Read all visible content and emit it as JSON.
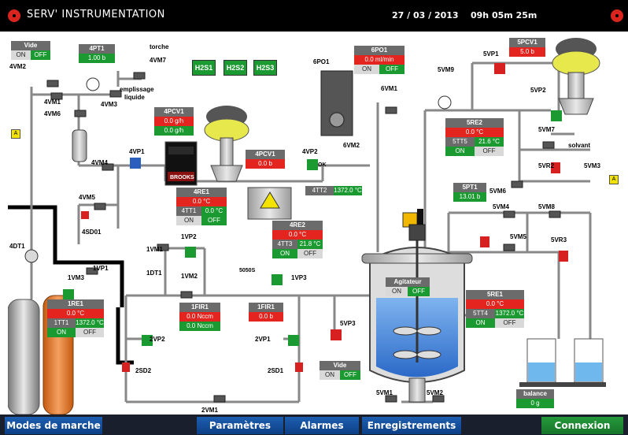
{
  "header": {
    "title": "SERV' INSTRUMENTATION",
    "date": "27 / 03 / 2013",
    "time": "09h 05m 25m"
  },
  "nav": {
    "modes": "Modes de marche",
    "params": "Paramètres",
    "alarms": "Alarmes",
    "records": "Enregistrements",
    "connect": "Connexion"
  },
  "labels": {
    "torche": "torche",
    "emplissage": "emplissage",
    "liquide": "liquide",
    "solvant": "solvant",
    "4vm2": "4VM2",
    "4vm7": "4VM7",
    "4vm1": "4VM1",
    "4vm3": "4VM3",
    "4vm6": "4VM6",
    "4vm4": "4VM4",
    "4vp1": "4VP1",
    "4vm5": "4VM5",
    "4sd01": "4SD01",
    "4dt1": "4DT1",
    "1vm3": "1VM3",
    "1vp1": "1VP1",
    "1dt1": "1DT1",
    "1vm2": "1VM2",
    "1vm1": "1VM1",
    "1vp2": "1VP2",
    "1vp3": "1VP3",
    "2vp2": "2VP2",
    "2sd2": "2SD2",
    "2vm1": "2VM1",
    "2vp1": "2VP1",
    "2sd1": "2SD1",
    "4vp2": "4VP2",
    "6po1": "6PO1",
    "6vm1": "6VM1",
    "6vm2": "6VM2",
    "5vp1": "5VP1",
    "5vm9": "5VM9",
    "5vp2": "5VP2",
    "5vm7": "5VM7",
    "5vr2": "5VR2",
    "5vm3": "5VM3",
    "5vm6": "5VM6",
    "5vm4": "5VM4",
    "5vm8": "5VM8",
    "5vm5": "5VM5",
    "5vr3": "5VR3",
    "5vp3": "5VP3",
    "5vm1": "5VM1",
    "5vm2": "5VM2",
    "h2s1": "H2S1",
    "h2s2": "H2S2",
    "h2s3": "H2S3",
    "a1": "A",
    "a2": "A",
    "brooks": "BROOKS",
    "ok": "OK",
    "sensor": "5050S"
  },
  "widgets": {
    "vide1": {
      "title": "Vide",
      "on": "ON",
      "off": "OFF"
    },
    "4pt1": {
      "title": "4PT1",
      "value": "1.00 b"
    },
    "4pcv1a": {
      "title": "4PCV1",
      "v1": "0.0 g/h",
      "v2": "0.0 g/h"
    },
    "4pcv1b": {
      "title": "4PCV1",
      "value": "0.0 b"
    },
    "6po1": {
      "title": "6PO1",
      "value": "0.0 ml/min",
      "on": "ON",
      "off": "OFF"
    },
    "5pcv1": {
      "title": "5PCV1",
      "value": "5.0 b"
    },
    "5re2": {
      "title": "5RE2",
      "value": "0.0 °C",
      "tag": "5TT5",
      "temp": "21.6 °C",
      "on": "ON",
      "off": "OFF"
    },
    "4tt2": {
      "tag": "4TT2",
      "temp": "1372.0 °C"
    },
    "4re1": {
      "title": "4RE1",
      "value": "0.0 °C",
      "tag": "4TT1",
      "temp": "0.0 °C",
      "on": "ON",
      "off": "OFF"
    },
    "5pt1": {
      "title": "5PT1",
      "value": "13.01 b"
    },
    "4re2": {
      "title": "4RE2",
      "value": "0.0 °C",
      "tag": "4TT3",
      "temp": "21.8 °C",
      "on": "ON",
      "off": "OFF"
    },
    "agitateur": {
      "title": "Agitateur",
      "on": "ON",
      "off": "OFF"
    },
    "1re1": {
      "title": "1RE1",
      "value": "0.0 °C",
      "tag": "1TT1",
      "temp": "1372.0 °C",
      "on": "ON",
      "off": "OFF"
    },
    "1fir1a": {
      "title": "1FIR1",
      "v1": "0.0 Nccm",
      "v2": "0.0 Nccm"
    },
    "1fir1b": {
      "title": "1FIR1",
      "value": "0.0 b"
    },
    "5re1": {
      "title": "5RE1",
      "value": "0.0 °C",
      "tag": "5TT4",
      "temp": "1372.0 °C",
      "on": "ON",
      "off": "OFF"
    },
    "vide2": {
      "title": "Vide",
      "on": "ON",
      "off": "OFF"
    },
    "balance": {
      "title": "balance",
      "value": "0 g"
    }
  },
  "colors": {
    "alarm_red": "#e3241f",
    "ok_green": "#1b9a31",
    "title_grey": "#6b6b6b",
    "nav_blue": "#1d5fb0"
  }
}
